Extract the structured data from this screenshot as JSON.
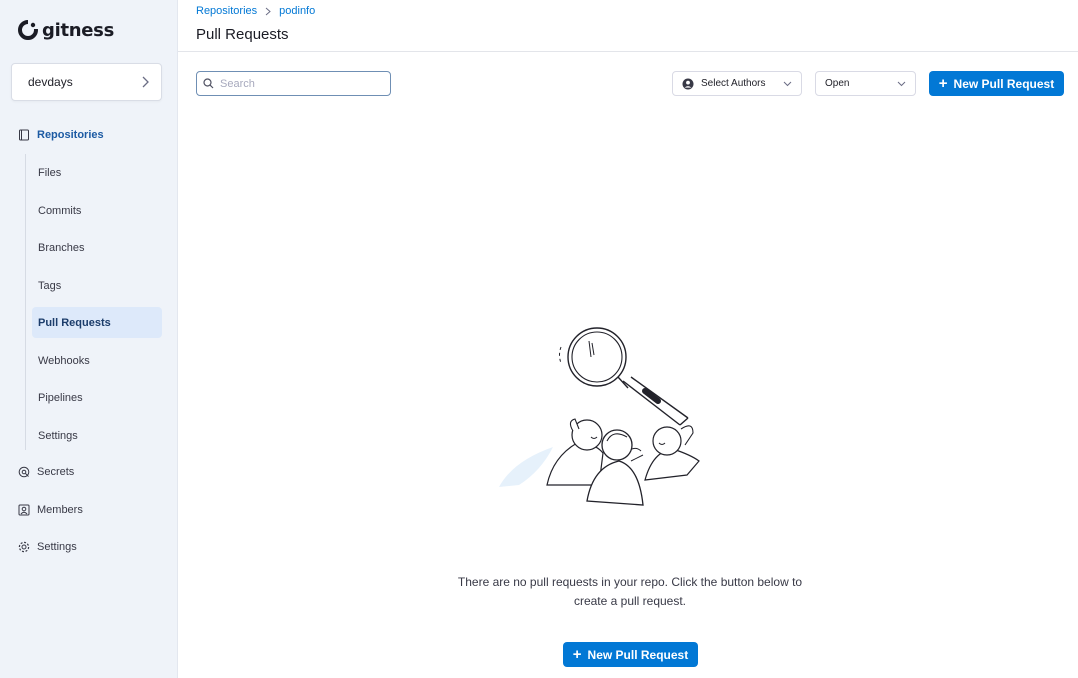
{
  "app": {
    "logo_text": "gitness"
  },
  "sidebar": {
    "repo_name": "devdays",
    "sections": {
      "repositories": "Repositories",
      "secrets": "Secrets",
      "members": "Members",
      "settings": "Settings"
    },
    "sub_items": [
      {
        "label": "Files"
      },
      {
        "label": "Commits"
      },
      {
        "label": "Branches"
      },
      {
        "label": "Tags"
      },
      {
        "label": "Pull Requests",
        "active": true
      },
      {
        "label": "Webhooks"
      },
      {
        "label": "Pipelines"
      },
      {
        "label": "Settings"
      }
    ]
  },
  "header": {
    "breadcrumb": [
      "Repositories",
      "podinfo"
    ],
    "title": "Pull Requests"
  },
  "toolbar": {
    "search_placeholder": "Search",
    "authors_label": "Select Authors",
    "state_label": "Open",
    "new_pr_label": "New Pull Request"
  },
  "empty_state": {
    "line1": "There are no pull requests in your repo. Click the button below to",
    "line2": "create a pull request.",
    "button_label": "New Pull Request"
  },
  "colors": {
    "accent": "#0278d5",
    "sidebar_bg": "#eff3f9",
    "active_item_bg": "#dde9fa"
  }
}
